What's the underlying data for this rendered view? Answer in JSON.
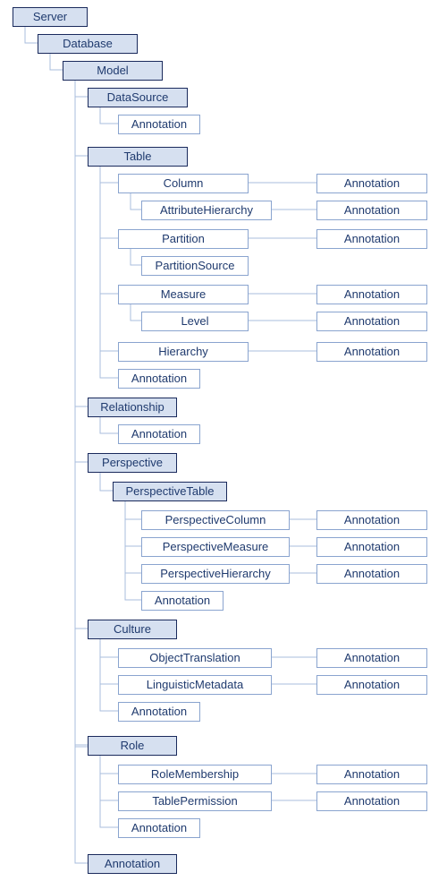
{
  "colors": {
    "darkBorder": "#1a2a5c",
    "lightBorder": "#8aa4cf",
    "fill": "#d6e0f0",
    "text": "#1f3a6e",
    "line": "#a9bedc"
  },
  "labels": {
    "server": "Server",
    "database": "Database",
    "model": "Model",
    "datasource": "DataSource",
    "annotation": "Annotation",
    "table": "Table",
    "column": "Column",
    "attributeHierarchy": "AttributeHierarchy",
    "partition": "Partition",
    "partitionSource": "PartitionSource",
    "measure": "Measure",
    "level": "Level",
    "hierarchy": "Hierarchy",
    "relationship": "Relationship",
    "perspective": "Perspective",
    "perspectiveTable": "PerspectiveTable",
    "perspectiveColumn": "PerspectiveColumn",
    "perspectiveMeasure": "PerspectiveMeasure",
    "perspectiveHierarchy": "PerspectiveHierarchy",
    "culture": "Culture",
    "objectTranslation": "ObjectTranslation",
    "linguisticMetadata": "LinguisticMetadata",
    "role": "Role",
    "roleMembership": "RoleMembership",
    "tablePermission": "TablePermission"
  }
}
